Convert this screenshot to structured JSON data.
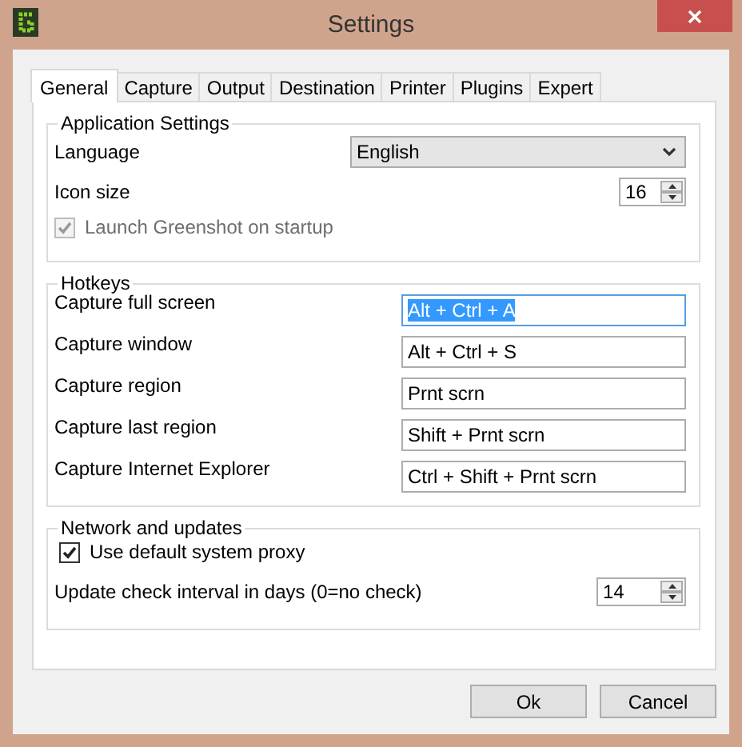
{
  "window": {
    "title": "Settings"
  },
  "tabs": [
    {
      "label": "General",
      "selected": true
    },
    {
      "label": "Capture",
      "selected": false
    },
    {
      "label": "Output",
      "selected": false
    },
    {
      "label": "Destination",
      "selected": false
    },
    {
      "label": "Printer",
      "selected": false
    },
    {
      "label": "Plugins",
      "selected": false
    },
    {
      "label": "Expert",
      "selected": false
    }
  ],
  "application_settings": {
    "title": "Application Settings",
    "language": {
      "label": "Language",
      "value": "English"
    },
    "icon_size": {
      "label": "Icon size",
      "value": "16"
    },
    "launch_on_startup": {
      "label": "Launch Greenshot on startup",
      "checked": true,
      "disabled": true
    }
  },
  "hotkeys": {
    "title": "Hotkeys",
    "items": [
      {
        "label": "Capture full screen",
        "value": "Alt + Ctrl + A",
        "focused": true
      },
      {
        "label": "Capture window",
        "value": "Alt + Ctrl + S",
        "focused": false
      },
      {
        "label": "Capture region",
        "value": "Prnt scrn",
        "focused": false
      },
      {
        "label": "Capture last region",
        "value": "Shift + Prnt scrn",
        "focused": false
      },
      {
        "label": "Capture Internet Explorer",
        "value": "Ctrl + Shift + Prnt scrn",
        "focused": false
      }
    ]
  },
  "network": {
    "title": "Network and updates",
    "use_proxy": {
      "label": "Use default system proxy",
      "checked": true,
      "disabled": false
    },
    "update_interval": {
      "label": "Update check interval in days (0=no check)",
      "value": "14"
    }
  },
  "buttons": [
    "Ok",
    "Cancel"
  ]
}
